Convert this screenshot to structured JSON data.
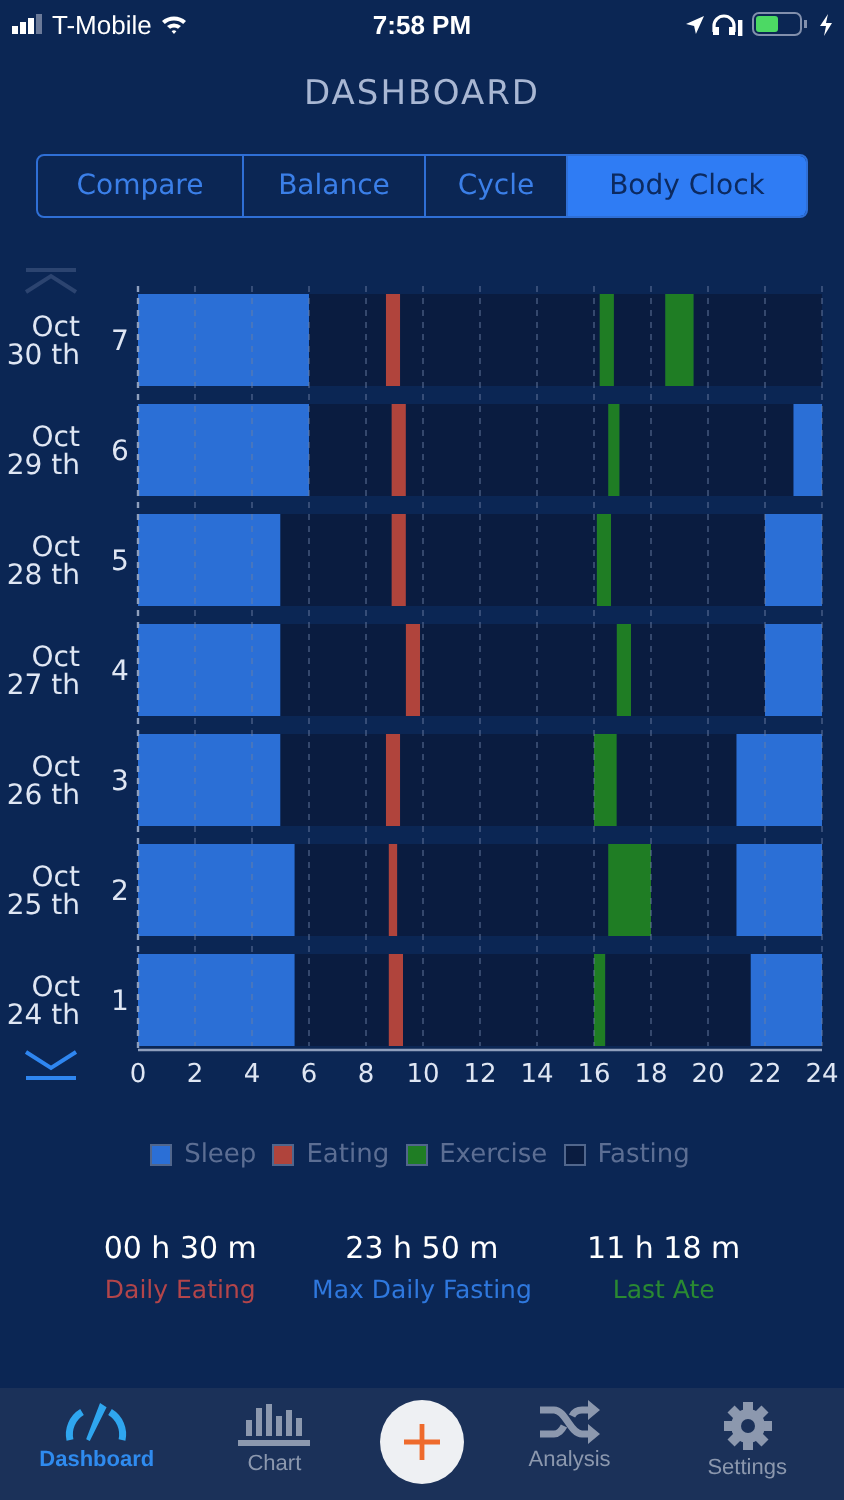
{
  "status_bar": {
    "carrier": "T-Mobile",
    "time": "7:58 PM"
  },
  "title": "DASHBOARD",
  "tabs": [
    {
      "label": "Compare",
      "selected": false
    },
    {
      "label": "Balance",
      "selected": false
    },
    {
      "label": "Cycle",
      "selected": false
    },
    {
      "label": "Body Clock",
      "selected": true
    }
  ],
  "row_dates": [
    {
      "month": "Oct",
      "day": "30 th"
    },
    {
      "month": "Oct",
      "day": "29 th"
    },
    {
      "month": "Oct",
      "day": "28 th"
    },
    {
      "month": "Oct",
      "day": "27 th"
    },
    {
      "month": "Oct",
      "day": "26 th"
    },
    {
      "month": "Oct",
      "day": "25 th"
    },
    {
      "month": "Oct",
      "day": "24 th"
    }
  ],
  "chart_data": {
    "type": "bar",
    "orientation": "horizontal",
    "stacked": true,
    "categories": [
      "7",
      "6",
      "5",
      "4",
      "3",
      "2",
      "1"
    ],
    "xlim": [
      0,
      24
    ],
    "xticks": [
      0,
      2,
      4,
      6,
      8,
      10,
      12,
      14,
      16,
      18,
      20,
      22,
      24
    ],
    "grid": true,
    "legend": true,
    "series": [
      {
        "name": "Sleep",
        "color": "#2b6fd6",
        "values": [
          6,
          6,
          5,
          5,
          5,
          5.5,
          5.5
        ]
      },
      {
        "color": "#0a1c40",
        "values": [
          2.7,
          2.9,
          3.9,
          4.4,
          3.7,
          3.3,
          3.3
        ]
      },
      {
        "name": "Eating",
        "color": "#b0443c",
        "values": [
          0.5,
          0.5,
          0.5,
          0.5,
          0.5,
          0.3,
          0.5
        ]
      },
      {
        "color": "#0a1c40",
        "values": [
          7.0,
          7.1,
          6.7,
          6.9,
          6.8,
          7.4,
          6.7
        ]
      },
      {
        "name": "Exercise",
        "color": "#1f7d24",
        "values": [
          0.5,
          0.4,
          0.5,
          0.5,
          0.8,
          1.5,
          0.4
        ]
      },
      {
        "color": "#0a1c40",
        "values": [
          1.8,
          0,
          0,
          0,
          0,
          0,
          0
        ]
      },
      {
        "color": "#1f7d24",
        "values": [
          1,
          0,
          0,
          0,
          0,
          0,
          0
        ]
      },
      {
        "name": "Fasting",
        "color": "#0a1c40",
        "values": [
          4.5,
          6.1,
          5.4,
          4.7,
          4.2,
          3,
          5.1
        ]
      },
      {
        "color": "#2b6fd6",
        "values": [
          0,
          1,
          2,
          2,
          3,
          3,
          2.5
        ]
      }
    ]
  },
  "stats": [
    {
      "value": "00 h 30 m",
      "label": "Daily Eating",
      "color": "#b3454a"
    },
    {
      "value": "23 h 50 m",
      "label": "Max Daily Fasting",
      "color": "#2f78de"
    },
    {
      "value": "11 h 18 m",
      "label": "Last Ate",
      "color": "#2a8a32"
    }
  ],
  "tab_bar": [
    {
      "kind": "gauge",
      "label": "Dashboard",
      "selected": true
    },
    {
      "kind": "chart",
      "label": "Chart",
      "selected": false
    },
    {
      "kind": "add"
    },
    {
      "kind": "shuffle",
      "label": "Analysis",
      "selected": false
    },
    {
      "kind": "gear",
      "label": "Settings",
      "selected": false
    }
  ]
}
